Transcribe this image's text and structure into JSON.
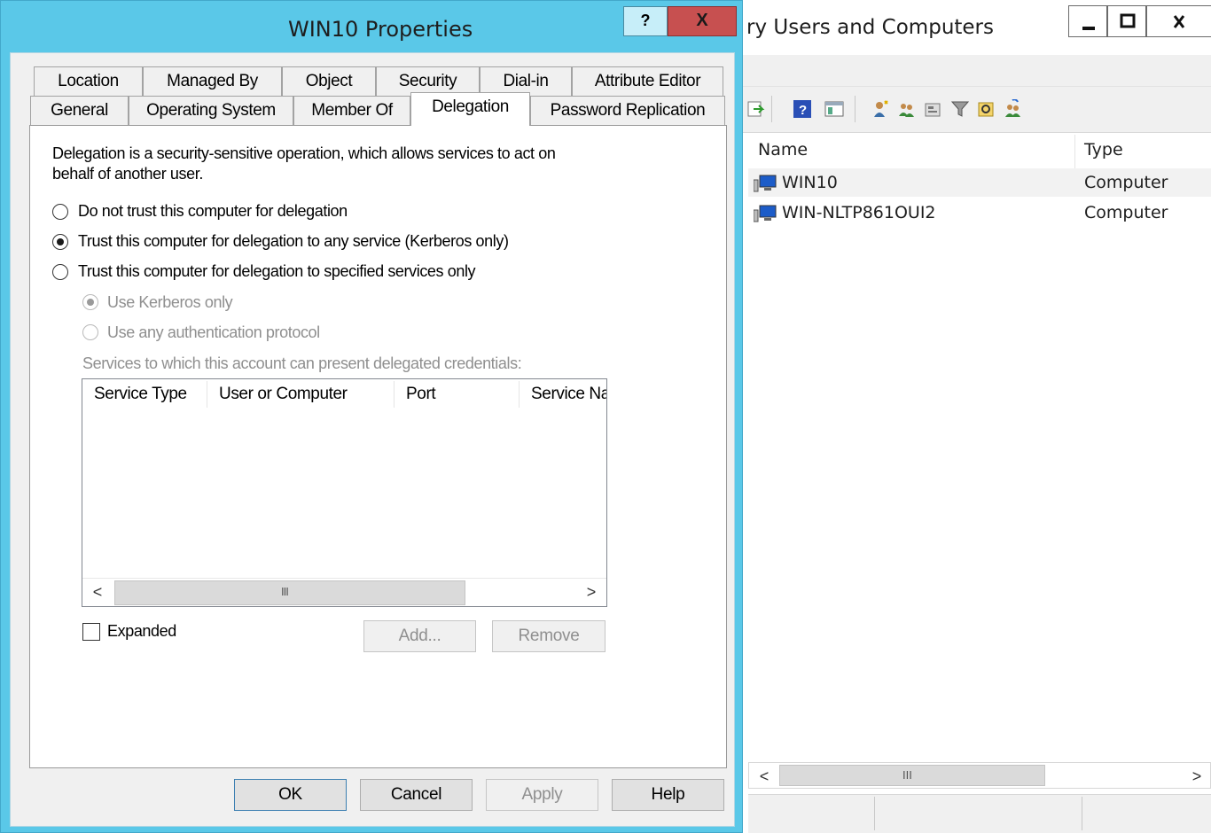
{
  "background_window": {
    "title": "ry Users and Computers",
    "columns": [
      "Name",
      "Type"
    ],
    "rows": [
      {
        "name": "WIN10",
        "type": "Computer",
        "selected": true
      },
      {
        "name": "WIN-NLTP861OUI2",
        "type": "Computer",
        "selected": false
      }
    ],
    "toolbar_icons": [
      "refresh-icon",
      "help-icon",
      "show-console-tree-icon",
      "new-user-icon",
      "new-group-icon",
      "new-ou-icon",
      "filter-icon",
      "find-icon",
      "add-to-group-icon"
    ],
    "scroll_grip": "III"
  },
  "dialog": {
    "title": "WIN10 Properties",
    "help_glyph": "?",
    "close_glyph": "X",
    "tabs_row1": [
      "Location",
      "Managed By",
      "Object",
      "Security",
      "Dial-in",
      "Attribute Editor"
    ],
    "tabs_row2": [
      "General",
      "Operating System",
      "Member Of",
      "Delegation",
      "Password Replication"
    ],
    "active_tab": "Delegation",
    "description_line1": "Delegation is a security-sensitive operation, which allows services to act on",
    "description_line2": "behalf of another user.",
    "options": {
      "no_trust": "Do not trust this computer for delegation",
      "trust_any": "Trust this computer for delegation to any service (Kerberos only)",
      "trust_specified": "Trust this computer for delegation to specified services only",
      "kerberos_only": "Use Kerberos only",
      "any_protocol": "Use any authentication protocol"
    },
    "selected_option": "trust_any",
    "services_label": "Services to which this account can present delegated credentials:",
    "services_columns": [
      "Service Type",
      "User or Computer",
      "Port",
      "Service Name"
    ],
    "scroll_left": "<",
    "scroll_right": ">",
    "scroll_grip": "III",
    "expanded_label": "Expanded",
    "expanded_checked": false,
    "add_label": "Add...",
    "remove_label": "Remove",
    "ok_label": "OK",
    "cancel_label": "Cancel",
    "apply_label": "Apply",
    "help_label": "Help"
  },
  "colors": {
    "title_bar": "#5ac8e8",
    "close_button": "#c75050",
    "dialog_face": "#f0f0f0"
  }
}
